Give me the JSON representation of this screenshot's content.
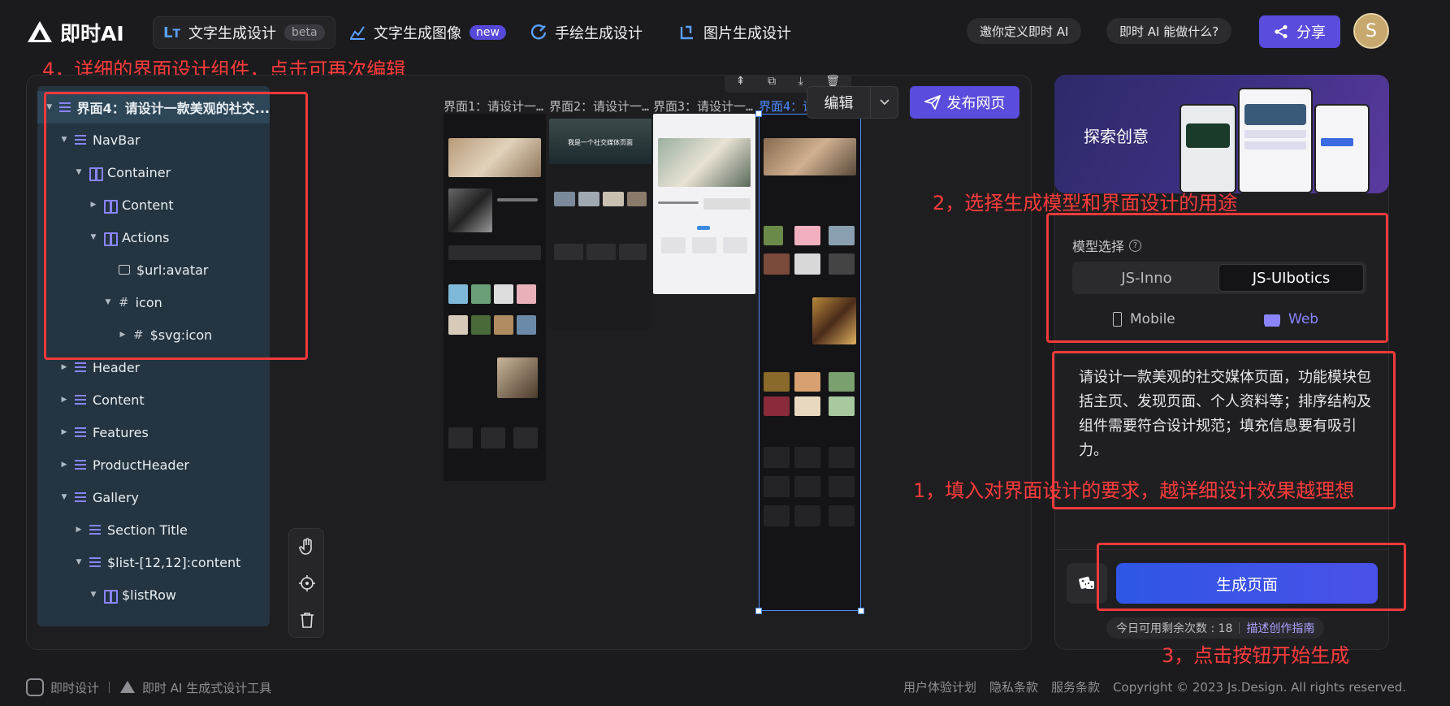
{
  "nav": {
    "logo": "即时AI",
    "tabs": [
      {
        "label": "文字生成设计",
        "badge": "beta"
      },
      {
        "label": "文字生成图像",
        "badge": "new"
      },
      {
        "label": "手绘生成设计"
      },
      {
        "label": "图片生成设计"
      }
    ],
    "pill1": "邀你定义即时 AI",
    "pill2": "即时 AI 能做什么?",
    "share": "分享",
    "avatar_initial": "S"
  },
  "annotations": {
    "n1": "1，填入对界面设计的要求，越详细设计效果越理想",
    "n2": "2，选择生成模型和界面设计的用途",
    "n3": "3，点击按钮开始生成",
    "n4": "4，详细的界面设计组件，点击可再次编辑"
  },
  "tree": [
    {
      "label": "界面4：请设计一款美观的社交...",
      "icon": "component",
      "caret": "down",
      "selected": true
    },
    {
      "label": "NavBar",
      "icon": "component",
      "caret": "down"
    },
    {
      "label": "Container",
      "icon": "container",
      "caret": "down"
    },
    {
      "label": "Content",
      "icon": "container",
      "caret": "right"
    },
    {
      "label": "Actions",
      "icon": "container",
      "caret": "down"
    },
    {
      "label": "$url:avatar",
      "icon": "image",
      "caret": ""
    },
    {
      "label": "icon",
      "icon": "frame",
      "caret": "down"
    },
    {
      "label": "$svg:icon",
      "icon": "frame",
      "caret": "right"
    },
    {
      "label": "Header",
      "icon": "component",
      "caret": "right"
    },
    {
      "label": "Content",
      "icon": "component",
      "caret": "right"
    },
    {
      "label": "Features",
      "icon": "component",
      "caret": "right"
    },
    {
      "label": "ProductHeader",
      "icon": "component",
      "caret": "right"
    },
    {
      "label": "Gallery",
      "icon": "component",
      "caret": "down"
    },
    {
      "label": "Section Title",
      "icon": "component",
      "caret": "right"
    },
    {
      "label": "$list-[12,12]:content",
      "icon": "component",
      "caret": "down"
    },
    {
      "label": "$listRow",
      "icon": "container",
      "caret": "down"
    }
  ],
  "frames": [
    {
      "label": "界面1：请设计一…"
    },
    {
      "label": "界面2：请设计一…"
    },
    {
      "label": "界面3：请设计一…"
    },
    {
      "label": "界面4：请"
    }
  ],
  "thumb_texts": {
    "t2_hero": "我是一个社交媒体页面"
  },
  "toolbar": {
    "edit": "编辑",
    "publish": "发布网页"
  },
  "panel": {
    "banner_title": "探索创意",
    "model_label": "模型选择",
    "models": [
      "JS-Inno",
      "JS-UIbotics"
    ],
    "selected_model": "JS-UIbotics",
    "platforms": [
      "Mobile",
      "Web"
    ],
    "selected_platform": "Web",
    "prompt": "请设计一款美观的社交媒体页面，功能模块包括主页、发现页面、个人资料等；排序结构及组件需要符合设计规范；填充信息要有吸引力。",
    "generate": "生成页面",
    "quota_label": "今日可用剩余次数 : 18",
    "guide": "描述创作指南"
  },
  "footer": {
    "brand1": "即时设计",
    "brand2": "即时 AI 生成式设计工具",
    "links": [
      "用户体验计划",
      "隐私条款",
      "服务条款"
    ],
    "copyright": "Copyright © 2023 Js.Design. All rights reserved."
  },
  "colors": {
    "accent": "#5a4cdc",
    "annotation_red": "#f03a3a",
    "tree_bg": "#243440",
    "selection_blue": "#4d8bff"
  }
}
